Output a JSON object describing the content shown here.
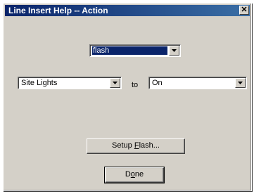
{
  "window": {
    "title": "Line Insert Help -- Action",
    "close_glyph": "✕"
  },
  "action_select": {
    "value": "flash"
  },
  "source_select": {
    "value": "Site Lights"
  },
  "connector_label": "to",
  "state_select": {
    "value": "On"
  },
  "buttons": {
    "setup_flash": {
      "pre": "Setup ",
      "accel": "F",
      "post": "lash..."
    },
    "done": {
      "pre": "D",
      "accel": "o",
      "post": "ne"
    }
  },
  "colors": {
    "face": "#d4d0c8",
    "titlebar": "#0a246a",
    "selection": "#0a246a"
  }
}
